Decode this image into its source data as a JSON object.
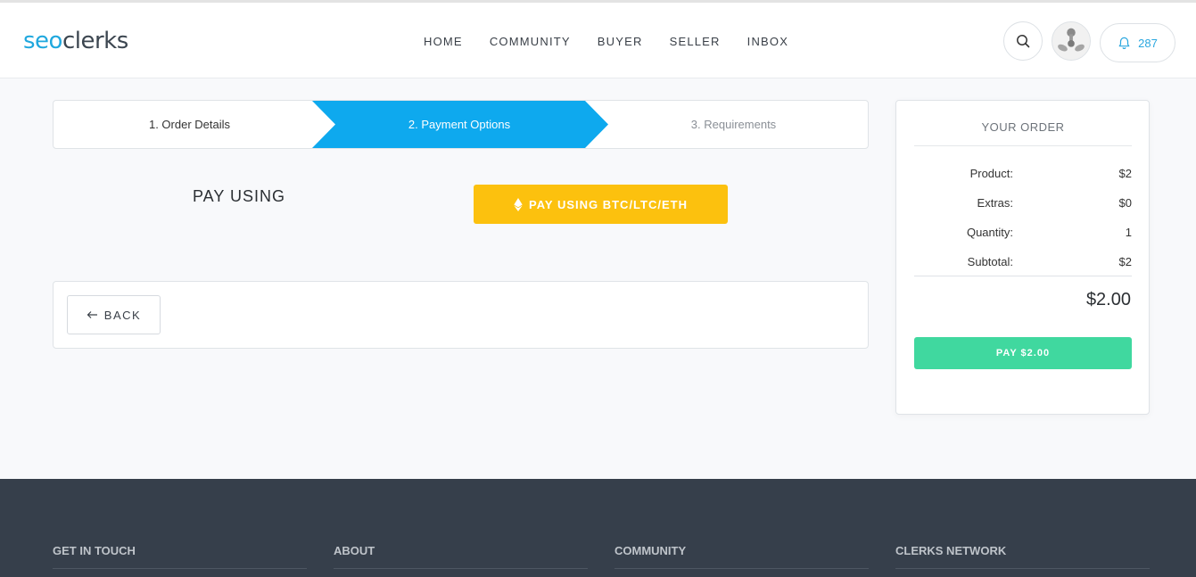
{
  "header": {
    "logo_seo": "seo",
    "logo_clerks": "clerks",
    "nav": [
      "HOME",
      "COMMUNITY",
      "BUYER",
      "SELLER",
      "INBOX"
    ],
    "notification_count": "287"
  },
  "steps": {
    "step1": "1. Order Details",
    "step2": "2. Payment Options",
    "step3": "3. Requirements",
    "active_color": "#0ea9ee"
  },
  "payment": {
    "label": "PAY USING",
    "crypto_button": "PAY USING BTC/LTC/ETH",
    "crypto_color": "#fcc10e"
  },
  "back": {
    "label": "BACK"
  },
  "order": {
    "title": "YOUR ORDER",
    "rows": [
      {
        "key": "Product:",
        "value": "$2"
      },
      {
        "key": "Extras:",
        "value": "$0"
      },
      {
        "key": "Quantity:",
        "value": "1"
      },
      {
        "key": "Subtotal:",
        "value": "$2"
      }
    ],
    "total": "$2.00",
    "pay_button": "PAY $2.00",
    "pay_color": "#40d89f"
  },
  "footer": {
    "columns": [
      "GET IN TOUCH",
      "ABOUT",
      "COMMUNITY",
      "CLERKS NETWORK"
    ]
  }
}
